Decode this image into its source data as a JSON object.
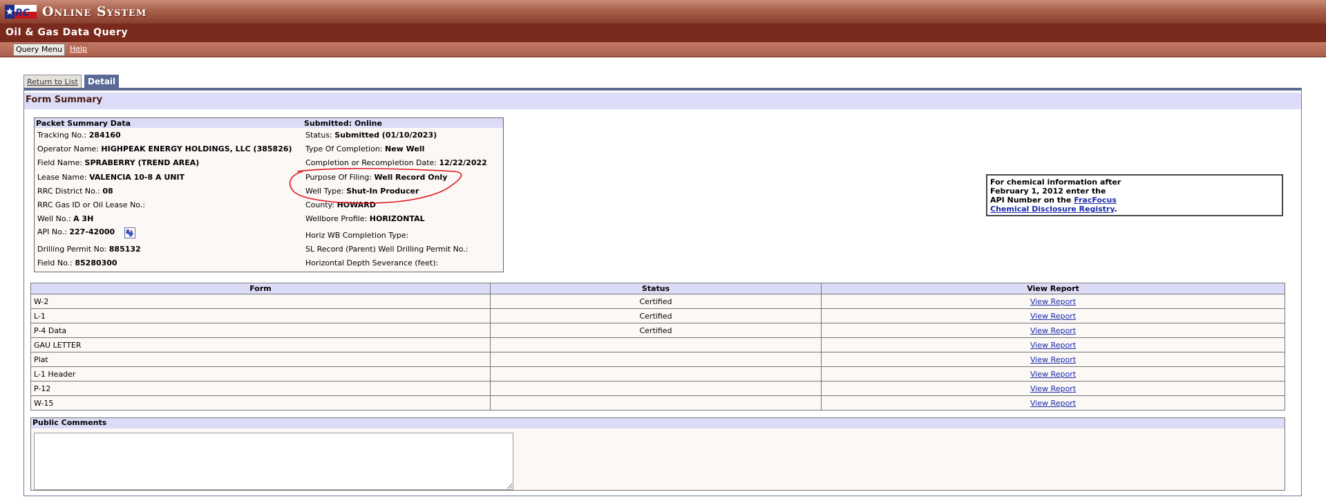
{
  "header": {
    "logo_text": "RRC",
    "app_title": "Online System",
    "sub_title": "Oil & Gas Data Query"
  },
  "menu": {
    "query_menu": "Query Menu",
    "help": "Help"
  },
  "tabs": {
    "return_to_list": "Return to List",
    "detail": "Detail"
  },
  "panel": {
    "title": "Form Summary"
  },
  "summary": {
    "heading": "Packet Summary Data",
    "submitted": "Submitted: Online",
    "left": [
      {
        "label": "Tracking No.:",
        "value": "284160"
      },
      {
        "label": "Operator Name:",
        "value": "HIGHPEAK ENERGY HOLDINGS, LLC (385826)"
      },
      {
        "label": "Field Name:",
        "value": "SPRABERRY (TREND AREA)"
      },
      {
        "label": "Lease Name:",
        "value": "VALENCIA 10-8 A UNIT"
      },
      {
        "label": "RRC District No.:",
        "value": "08"
      },
      {
        "label": "RRC Gas ID or Oil Lease No.:",
        "value": ""
      },
      {
        "label": "Well No.:",
        "value": "A 3H"
      },
      {
        "label": "API No.:",
        "value": "227-42000"
      },
      {
        "label": "Drilling Permit No:",
        "value": "885132"
      },
      {
        "label": "Field No.:",
        "value": "85280300"
      }
    ],
    "right": [
      {
        "label": "Status:",
        "value": "Submitted (01/10/2023)"
      },
      {
        "label": "Type Of Completion:",
        "value": "New Well"
      },
      {
        "label": "Completion or Recompletion Date:",
        "value": "12/22/2022"
      },
      {
        "label": "Purpose Of Filing:",
        "value": "Well Record Only"
      },
      {
        "label": "Well Type:",
        "value": "Shut-In Producer"
      },
      {
        "label": "County:",
        "value": "HOWARD"
      },
      {
        "label": "Wellbore Profile:",
        "value": "HORIZONTAL"
      },
      {
        "label": "Horiz WB Completion Type:",
        "value": ""
      },
      {
        "label": "SL Record (Parent) Well Drilling Permit No.:",
        "value": ""
      },
      {
        "label": "Horizontal Depth Severance (feet):",
        "value": ""
      }
    ],
    "api_icon": "texas-map-icon"
  },
  "chem": {
    "line1": "For chemical information after",
    "line2": "February 1, 2012 enter the",
    "line3": "API Number on the ",
    "link1": "FracFocus",
    "link2": "Chemical Disclosure Registry",
    "end": "."
  },
  "forms_table": {
    "headers": [
      "Form",
      "Status",
      "View Report"
    ],
    "rows": [
      {
        "form": "W-2",
        "status": "Certified",
        "link": "View Report"
      },
      {
        "form": "L-1",
        "status": "Certified",
        "link": "View Report"
      },
      {
        "form": "P-4 Data",
        "status": "Certified",
        "link": "View Report"
      },
      {
        "form": "GAU LETTER",
        "status": "",
        "link": "View Report"
      },
      {
        "form": "Plat",
        "status": "",
        "link": "View Report"
      },
      {
        "form": "L-1 Header",
        "status": "",
        "link": "View Report"
      },
      {
        "form": "P-12",
        "status": "",
        "link": "View Report"
      },
      {
        "form": "W-15",
        "status": "",
        "link": "View Report"
      }
    ]
  },
  "comments": {
    "heading": "Public Comments",
    "value": ""
  },
  "colors": {
    "brand": "#8a3f2c",
    "tab_active": "#5a6a95",
    "header_fill": "#dcdcf8",
    "link": "#1a2aa8",
    "annotation": "#e0141e"
  }
}
